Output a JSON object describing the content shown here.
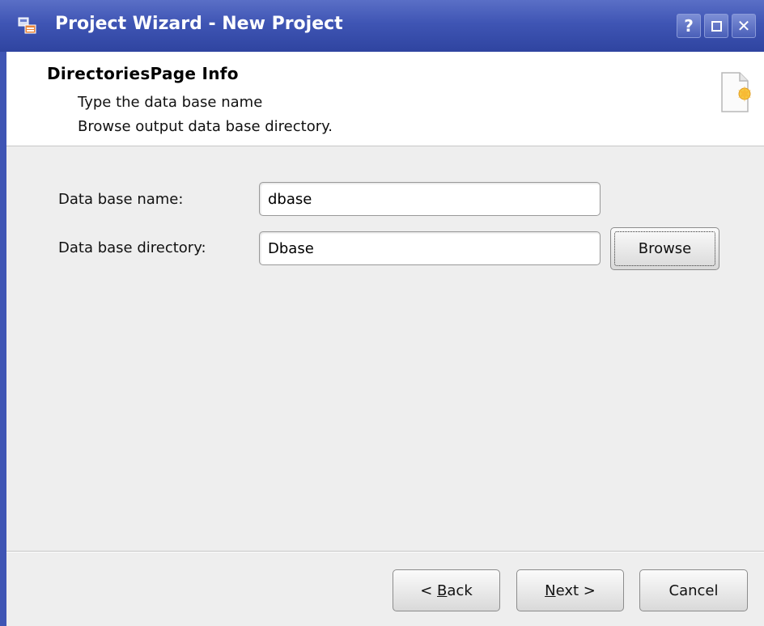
{
  "window": {
    "title": "Project Wizard - New Project",
    "help_label": "?",
    "close_label": "✕"
  },
  "header": {
    "title": "DirectoriesPage Info",
    "line1": "Type the data base name",
    "line2": "Browse output data base directory."
  },
  "form": {
    "name_label": "Data base name:",
    "name_value": "dbase",
    "dir_label": "Data base directory:",
    "dir_value": "Dbase",
    "browse_label": "Browse"
  },
  "footer": {
    "back_prefix": "< ",
    "back_mnemonic": "B",
    "back_rest": "ack",
    "next_mnemonic": "N",
    "next_rest": "ext >",
    "cancel_label": "Cancel"
  },
  "colors": {
    "titlebar": "#3f55b4",
    "dialog_bg": "#eeeeee",
    "header_bg": "#ffffff"
  }
}
